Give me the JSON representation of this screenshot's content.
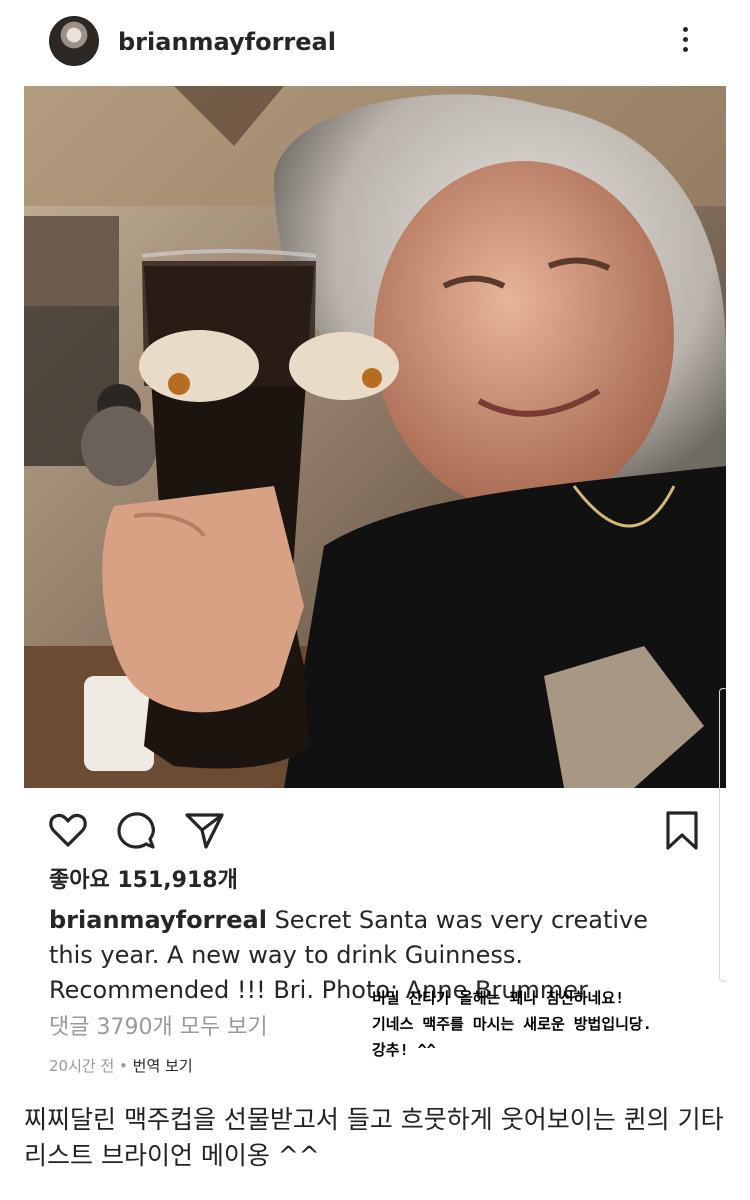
{
  "post": {
    "username": "brianmayforreal",
    "likes_label": "좋아요 151,918개",
    "caption_username": "brianmayforreal",
    "caption_text": " Secret Santa was very creative this year.  A new way to drink Guinness. Recommended !!! Bri. Photo: Anne Brummer",
    "comments_link": "댓글 3790개 모두 보기",
    "time": "20시간 전",
    "separator": " • ",
    "translate_label": "번역 보기"
  },
  "overlay_note": {
    "lines": [
      "비밀 산타가 올해는 꽤나 참신하네요!",
      "기네스 맥주를 마시는 새로운 방법입니당.",
      "강추! ^^"
    ]
  },
  "footer_text": "찌찌달린 맥주컵을 선물받고서 들고 흐뭇하게 웃어보이는 퀸의 기타리스트 브라이언 메이옹 ^^",
  "icons": {
    "like": "heart-icon",
    "comment": "comment-bubble-icon",
    "share": "paper-plane-icon",
    "save": "bookmark-icon",
    "more": "vertical-ellipsis-icon"
  }
}
